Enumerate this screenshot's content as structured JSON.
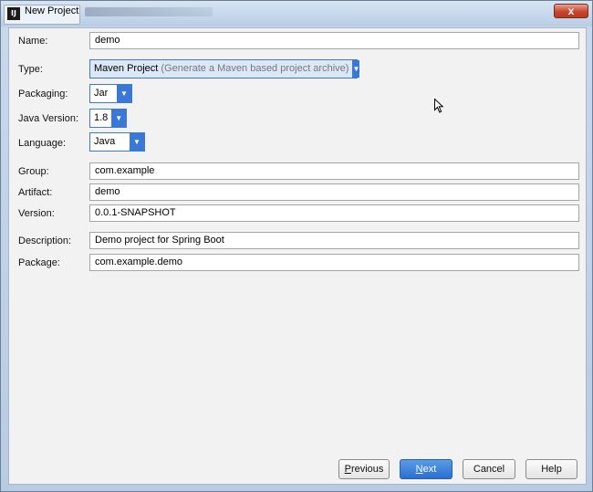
{
  "window": {
    "title": "New Project",
    "close_glyph": "x"
  },
  "form": {
    "name": {
      "label": "Name:",
      "value": "demo"
    },
    "type": {
      "label": "Type:",
      "value": "Maven Project",
      "hint": "(Generate a Maven based project archive)"
    },
    "packaging": {
      "label": "Packaging:",
      "value": "Jar"
    },
    "java_version": {
      "label": "Java Version:",
      "value": "1.8"
    },
    "language": {
      "label": "Language:",
      "value": "Java"
    },
    "group": {
      "label": "Group:",
      "value": "com.example"
    },
    "artifact": {
      "label": "Artifact:",
      "value": "demo"
    },
    "version": {
      "label": "Version:",
      "value": "0.0.1-SNAPSHOT"
    },
    "description": {
      "label": "Description:",
      "value": "Demo project for Spring Boot"
    },
    "package": {
      "label": "Package:",
      "value": "com.example.demo"
    }
  },
  "buttons": {
    "previous": {
      "mnemonic": "P",
      "rest": "revious"
    },
    "next": {
      "mnemonic": "N",
      "rest": "ext"
    },
    "cancel": "Cancel",
    "help": "Help"
  },
  "colors": {
    "accent": "#3a78d6",
    "close": "#c8452d"
  },
  "icons": {
    "app": "intellij-icon",
    "dropdown": "chevron-down-icon",
    "cursor": "mouse-pointer-icon"
  }
}
